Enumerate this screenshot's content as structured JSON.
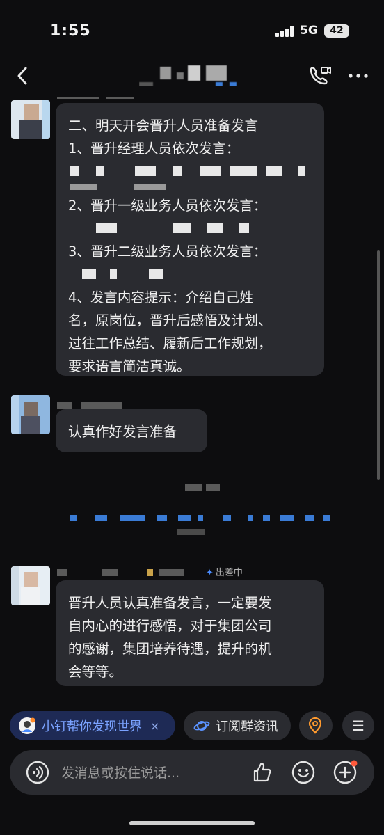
{
  "status": {
    "time": "1:55",
    "network": "5G",
    "battery": "42"
  },
  "header": {
    "title": ""
  },
  "messages": [
    {
      "lines": [
        "二、明天开会晋升人员准备发言",
        "1、晋升经理人员依次发言：",
        "",
        "",
        "2、晋升一级业务人员依次发言：",
        "",
        "3、晋升二级业务人员依次发言：",
        "",
        "4、发言内容提示：介绍自己姓",
        "名，原岗位，晋升后感悟及计划、",
        "过往工作总结、履新后工作规划，",
        "要求语言简洁真诚。"
      ]
    },
    {
      "text": "认真作好发言准备"
    },
    {
      "badge": "出差中",
      "lines": [
        "晋升人员认真准备发言，一定要发",
        "自内心的进行感悟，对于集团公司",
        "的感谢，集团培养待遇，提升的机",
        "会等等。"
      ]
    }
  ],
  "quickbar": {
    "assistant_label": "小钉帮你发现世界",
    "close_label": "×",
    "subscribe_label": "订阅群资讯",
    "menu_label": "☰"
  },
  "composer": {
    "placeholder": "发消息或按住说话..."
  },
  "colors": {
    "accent": "#4a8cff",
    "bubble": "#2a2b30",
    "badge_dot": "#ff5a3c"
  }
}
